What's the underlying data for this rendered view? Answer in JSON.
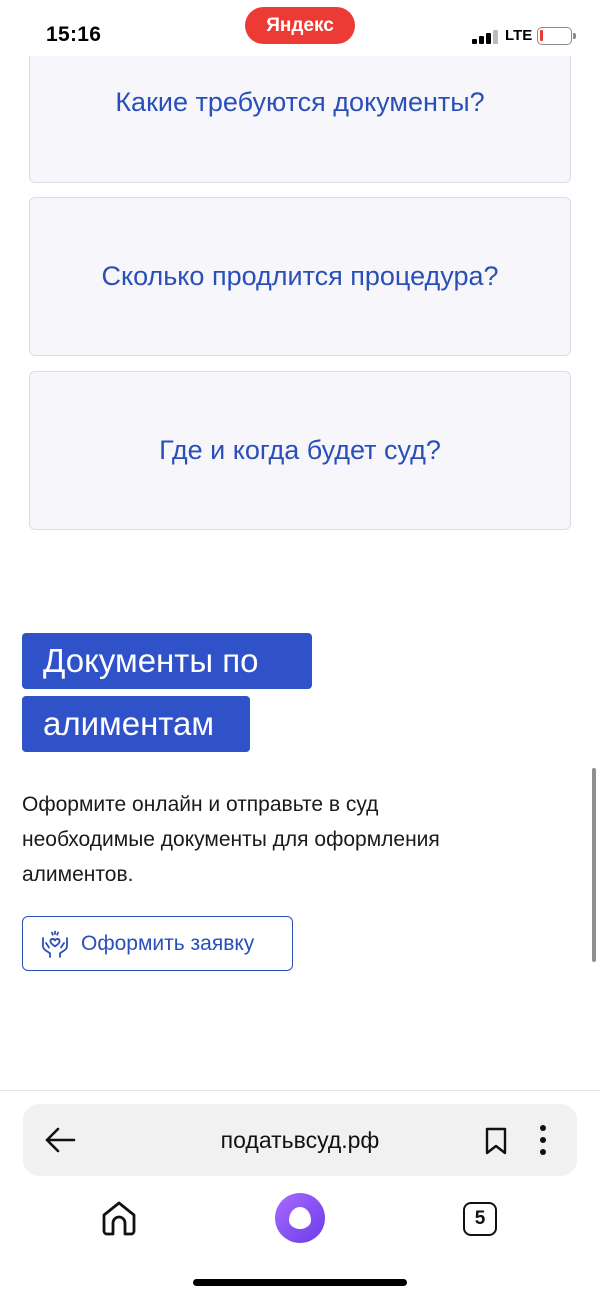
{
  "status_bar": {
    "time": "15:16",
    "browser_pill": "Яндекс",
    "network": "LTE",
    "battery_level": 0.1
  },
  "faq": {
    "items": [
      {
        "label": "Какие требуются документы?"
      },
      {
        "label": "Сколько продлится процедура?"
      },
      {
        "label": "Где и когда будет суд?"
      }
    ]
  },
  "section": {
    "heading_line_1": "Документы по",
    "heading_line_2": "алиментам",
    "description": "Оформите онлайн и отправьте в суд необходимые документы для оформления алиментов.",
    "button_label": "Оформить заявку"
  },
  "browser": {
    "url": "податьвсуд.рф",
    "tabs_count": "5"
  },
  "colors": {
    "accent": "#2f52c8",
    "link": "#2a4fb8",
    "pill": "#ec3b35",
    "alice": "#8b55f5"
  }
}
